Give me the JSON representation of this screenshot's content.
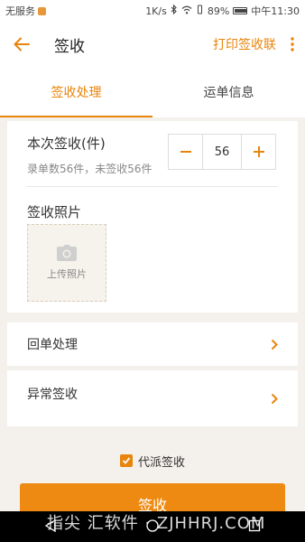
{
  "status_bar": {
    "carrier": "无服务",
    "speed": "1K/s",
    "battery": "89%",
    "battery_level": 0.89,
    "time": "中午11:30"
  },
  "app_bar": {
    "title": "签收",
    "print_label": "打印签收联"
  },
  "tabs": [
    {
      "label": "签收处理",
      "active": true
    },
    {
      "label": "运单信息",
      "active": false
    }
  ],
  "sign": {
    "qty_label": "本次签收(件)",
    "qty_summary": "录单数56件，未签收56件",
    "qty_value": "56",
    "minus": "−",
    "plus": "+"
  },
  "photo": {
    "label": "签收照片",
    "upload_label": "上传照片"
  },
  "rows": {
    "return_label": "回单处理",
    "abnormal_label": "异常签收"
  },
  "agent": {
    "label": "代派签收",
    "checked": true
  },
  "submit_label": "签收",
  "watermark": "指尖 汇软件 · ZJHHRJ.COM",
  "colors": {
    "accent": "#e8850c",
    "background": "#f4f1ec"
  }
}
